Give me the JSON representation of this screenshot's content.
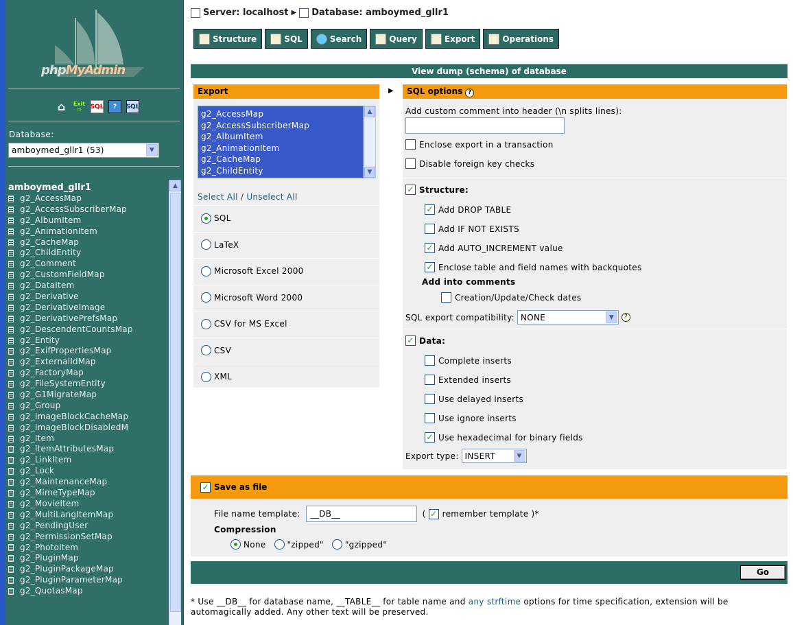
{
  "sidebar": {
    "logo_text": "phpMyAdmin",
    "nav_icons": [
      "home-icon",
      "exit-icon",
      "sql-window-icon",
      "help-icon",
      "sql-docs-icon"
    ],
    "nav_icon_labels": {
      "exit": "Exit",
      "sql": "SQL",
      "sql2": "SQL"
    },
    "database_label": "Database:",
    "database_selected": "amboymed_gllr1 (53)",
    "tree_title": "amboymed_gllr1",
    "tables": [
      "g2_AccessMap",
      "g2_AccessSubscriberMap",
      "g2_AlbumItem",
      "g2_AnimationItem",
      "g2_CacheMap",
      "g2_ChildEntity",
      "g2_Comment",
      "g2_CustomFieldMap",
      "g2_DataItem",
      "g2_Derivative",
      "g2_DerivativeImage",
      "g2_DerivativePrefsMap",
      "g2_DescendentCountsMap",
      "g2_Entity",
      "g2_ExifPropertiesMap",
      "g2_ExternalIdMap",
      "g2_FactoryMap",
      "g2_FileSystemEntity",
      "g2_G1MigrateMap",
      "g2_Group",
      "g2_ImageBlockCacheMap",
      "g2_ImageBlockDisabledM",
      "g2_Item",
      "g2_ItemAttributesMap",
      "g2_LinkItem",
      "g2_Lock",
      "g2_MaintenanceMap",
      "g2_MimeTypeMap",
      "g2_MovieItem",
      "g2_MultiLangItemMap",
      "g2_PendingUser",
      "g2_PermissionSetMap",
      "g2_PhotoItem",
      "g2_PluginMap",
      "g2_PluginPackageMap",
      "g2_PluginParameterMap",
      "g2_QuotasMap"
    ]
  },
  "breadcrumb": {
    "server": "Server: localhost",
    "database": "Database: amboymed_gllr1"
  },
  "tabs": [
    {
      "label": "Structure"
    },
    {
      "label": "SQL"
    },
    {
      "label": "Search"
    },
    {
      "label": "Query"
    },
    {
      "label": "Export"
    },
    {
      "label": "Operations"
    }
  ],
  "page_title": "View dump (schema) of database",
  "export": {
    "heading": "Export",
    "list_visible": [
      "g2_AccessMap",
      "g2_AccessSubscriberMap",
      "g2_AlbumItem",
      "g2_AnimationItem",
      "g2_CacheMap",
      "g2_ChildEntity"
    ],
    "select_all": "Select All",
    "separator": "/",
    "unselect_all": "Unselect All",
    "formats": [
      {
        "label": "SQL",
        "selected": true
      },
      {
        "label": "LaTeX",
        "selected": false
      },
      {
        "label": "Microsoft Excel 2000",
        "selected": false
      },
      {
        "label": "Microsoft Word 2000",
        "selected": false
      },
      {
        "label": "CSV for MS Excel",
        "selected": false
      },
      {
        "label": "CSV",
        "selected": false
      },
      {
        "label": "XML",
        "selected": false
      }
    ]
  },
  "sql_options": {
    "heading": "SQL options",
    "comment_label": "Add custom comment into header (\\n splits lines):",
    "comment_value": "",
    "transaction": {
      "label": "Enclose export in a transaction",
      "checked": false
    },
    "foreign_keys": {
      "label": "Disable foreign key checks",
      "checked": false
    },
    "structure": {
      "label": "Structure:",
      "checked": true
    },
    "drop_table": {
      "label": "Add DROP TABLE",
      "checked": true
    },
    "if_not_exists": {
      "label": "Add IF NOT EXISTS",
      "checked": false
    },
    "auto_increment": {
      "label": "Add AUTO_INCREMENT value",
      "checked": true
    },
    "backquotes": {
      "label": "Enclose table and field names with backquotes",
      "checked": true
    },
    "add_comments_label": "Add into comments",
    "dates": {
      "label": "Creation/Update/Check dates",
      "checked": false
    },
    "compat_label": "SQL export compatibility:",
    "compat_value": "NONE",
    "data": {
      "label": "Data:",
      "checked": true
    },
    "complete_inserts": {
      "label": "Complete inserts",
      "checked": false
    },
    "extended_inserts": {
      "label": "Extended inserts",
      "checked": false
    },
    "delayed_inserts": {
      "label": "Use delayed inserts",
      "checked": false
    },
    "ignore_inserts": {
      "label": "Use ignore inserts",
      "checked": false
    },
    "hex_binary": {
      "label": "Use hexadecimal for binary fields",
      "checked": true
    },
    "export_type_label": "Export type:",
    "export_type_value": "INSERT"
  },
  "save": {
    "heading": "Save as file",
    "checked": true,
    "template_label": "File name template:",
    "template_value": "__DB__",
    "paren_open": "(",
    "remember_label": "remember template",
    "paren_close": ")*",
    "remember_checked": true,
    "compression_label": "Compression",
    "compression": [
      {
        "label": "None",
        "selected": true
      },
      {
        "label": "\"zipped\"",
        "selected": false
      },
      {
        "label": "\"gzipped\"",
        "selected": false
      }
    ]
  },
  "go_label": "Go",
  "footnote": {
    "part1": "* Use __DB__ for database name, __TABLE__ for table name and ",
    "link": "any strftime",
    "part2": " options for time specification, extension will be automagically added. Any other text will be preserved."
  }
}
